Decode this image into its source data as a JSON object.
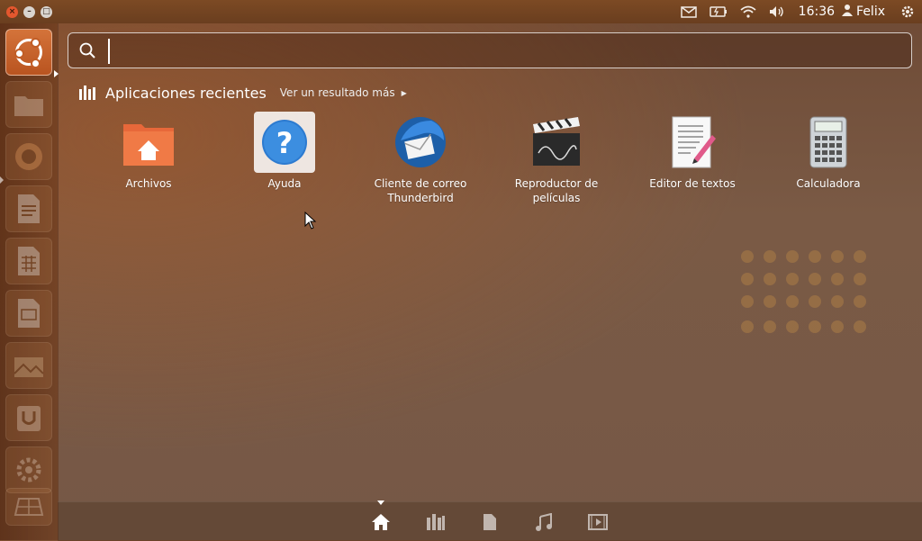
{
  "top_panel": {
    "clock": "16:36",
    "user_name": "Felix",
    "icons": [
      "mail-icon",
      "battery-icon",
      "wifi-icon",
      "volume-icon",
      "user-icon",
      "gear-icon"
    ]
  },
  "launcher": {
    "items": [
      {
        "name": "dash-home",
        "icon": "ubuntu-logo-icon",
        "active": true
      },
      {
        "name": "files",
        "icon": "folder-icon"
      },
      {
        "name": "firefox",
        "icon": "firefox-icon"
      },
      {
        "name": "writer",
        "icon": "document-icon"
      },
      {
        "name": "calc",
        "icon": "spreadsheet-icon"
      },
      {
        "name": "impress",
        "icon": "presentation-icon"
      },
      {
        "name": "shotwell",
        "icon": "photos-icon"
      },
      {
        "name": "software-center",
        "icon": "software-center-icon"
      },
      {
        "name": "settings",
        "icon": "settings-icon"
      },
      {
        "name": "workspaces",
        "icon": "workspaces-icon"
      }
    ]
  },
  "search": {
    "value": "",
    "placeholder": ""
  },
  "category": {
    "title": "Aplicaciones recientes",
    "see_more": "Ver un resultado más"
  },
  "apps": [
    {
      "label_line1": "Archivos",
      "label_line2": "",
      "icon": "home-folder-icon"
    },
    {
      "label_line1": "Ayuda",
      "label_line2": "",
      "icon": "help-icon"
    },
    {
      "label_line1": "Cliente de correo",
      "label_line2": "Thunderbird",
      "icon": "thunderbird-icon"
    },
    {
      "label_line1": "Reproductor de",
      "label_line2": "películas",
      "icon": "clapperboard-icon"
    },
    {
      "label_line1": "Editor de textos",
      "label_line2": "",
      "icon": "text-editor-icon"
    },
    {
      "label_line1": "Calculadora",
      "label_line2": "",
      "icon": "calculator-icon"
    }
  ],
  "lenses": [
    {
      "name": "home",
      "icon": "home-icon",
      "active": true
    },
    {
      "name": "applications",
      "icon": "applications-icon"
    },
    {
      "name": "files",
      "icon": "file-icon"
    },
    {
      "name": "music",
      "icon": "music-icon"
    },
    {
      "name": "video",
      "icon": "video-icon"
    }
  ],
  "colors": {
    "accent": "#d4733a",
    "panel": "#6a3e1f"
  }
}
